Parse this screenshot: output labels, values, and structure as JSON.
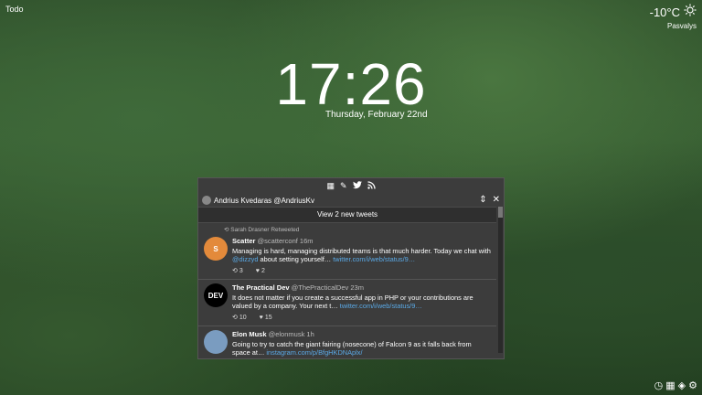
{
  "todo_label": "Todo",
  "weather": {
    "temperature": "-10°C",
    "location": "Pasvalys",
    "icon": "sun-icon"
  },
  "clock": {
    "time": "17:26",
    "date": "Thursday, February 22nd"
  },
  "panel": {
    "tabs": [
      "grid-icon",
      "compose-icon",
      "twitter-icon",
      "rss-icon"
    ],
    "account": {
      "name": "Andrius Kvedaras",
      "handle": "@AndriusKv"
    },
    "new_tweets_label": "View 2 new tweets",
    "tweets": [
      {
        "retweet_note": "Sarah Drasner Retweeted",
        "name": "Scatter",
        "handle": "@scatterconf",
        "time": "16m",
        "text_part1": "Managing is hard, managing distributed teams is that much harder. Today we chat with",
        "mention": "@dizzyd",
        "text_part2": "about setting yourself…",
        "link": "twitter.com/i/web/status/9…",
        "retweets": "3",
        "likes": "2"
      },
      {
        "name": "The Practical Dev",
        "handle": "@ThePracticalDev",
        "time": "23m",
        "text_part1": "It does not matter if you create a successful app in PHP or your contributions are valued by a company. Your next t…",
        "link": "twitter.com/i/web/status/9…",
        "retweets": "10",
        "likes": "15",
        "avatar_text": "DEV"
      },
      {
        "name": "Elon Musk",
        "handle": "@elonmusk",
        "time": "1h",
        "text_part1": "Going to try to catch the giant fairing (nosecone) of Falcon 9 as it falls back from space at…",
        "link": "instagram.com/p/BfgHKDNAplx/"
      }
    ]
  },
  "bottom_icons": [
    "clock-icon",
    "calendar-icon",
    "dropbox-icon",
    "gear-icon"
  ]
}
